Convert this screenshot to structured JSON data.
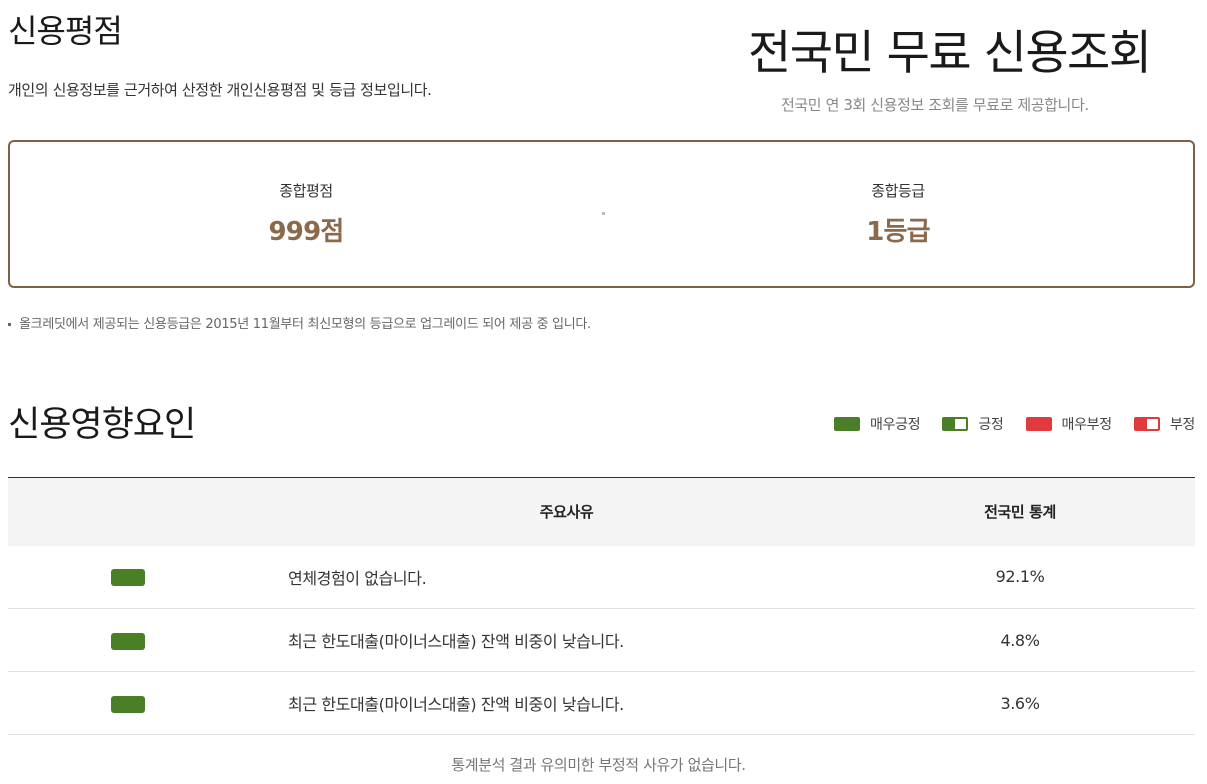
{
  "credit": {
    "title": "신용평점",
    "description": "개인의 신용정보를 근거하여 산정한 개인신용평점 및 등급 정보입니다.",
    "score_label": "종합평점",
    "score_value": "999점",
    "grade_label": "종합등급",
    "grade_value": "1등급",
    "footnote": "올크레딧에서 제공되는 신용등급은 2015년 11월부터 최신모형의 등급으로 업그레이드 되어 제공 중 입니다."
  },
  "promo": {
    "title": "전국민 무료 신용조회",
    "subtitle": "전국민 연 3회 신용정보 조회를 무료로 제공합니다."
  },
  "factors": {
    "title": "신용영향요인",
    "legend": [
      {
        "label": "매우긍정",
        "style": "full-green",
        "color": "#4a7f27"
      },
      {
        "label": "긍정",
        "style": "half-green",
        "color": "#4a7f27"
      },
      {
        "label": "매우부정",
        "style": "full-red",
        "color": "#e03a3e"
      },
      {
        "label": "부정",
        "style": "half-red",
        "color": "#e03a3e"
      }
    ],
    "table": {
      "headers": {
        "reason": "주요사유",
        "stat": "전국민 통계"
      },
      "rows": [
        {
          "indicator": "매우긍정",
          "reason": "연체경험이 없습니다.",
          "stat": "92.1%"
        },
        {
          "indicator": "매우긍정",
          "reason": "최근 한도대출(마이너스대출) 잔액 비중이 낮습니다.",
          "stat": "4.8%"
        },
        {
          "indicator": "매우긍정",
          "reason": "최근 한도대출(마이너스대출) 잔액 비중이 낮습니다.",
          "stat": "3.6%"
        }
      ]
    },
    "bottom_note": "통계분석 결과 유의미한 부정적 사유가 없습니다."
  },
  "colors": {
    "accent_brown": "#8b6a4c",
    "border_brown": "#7c6248",
    "positive_green": "#4a7f27",
    "negative_red": "#e03a3e"
  }
}
